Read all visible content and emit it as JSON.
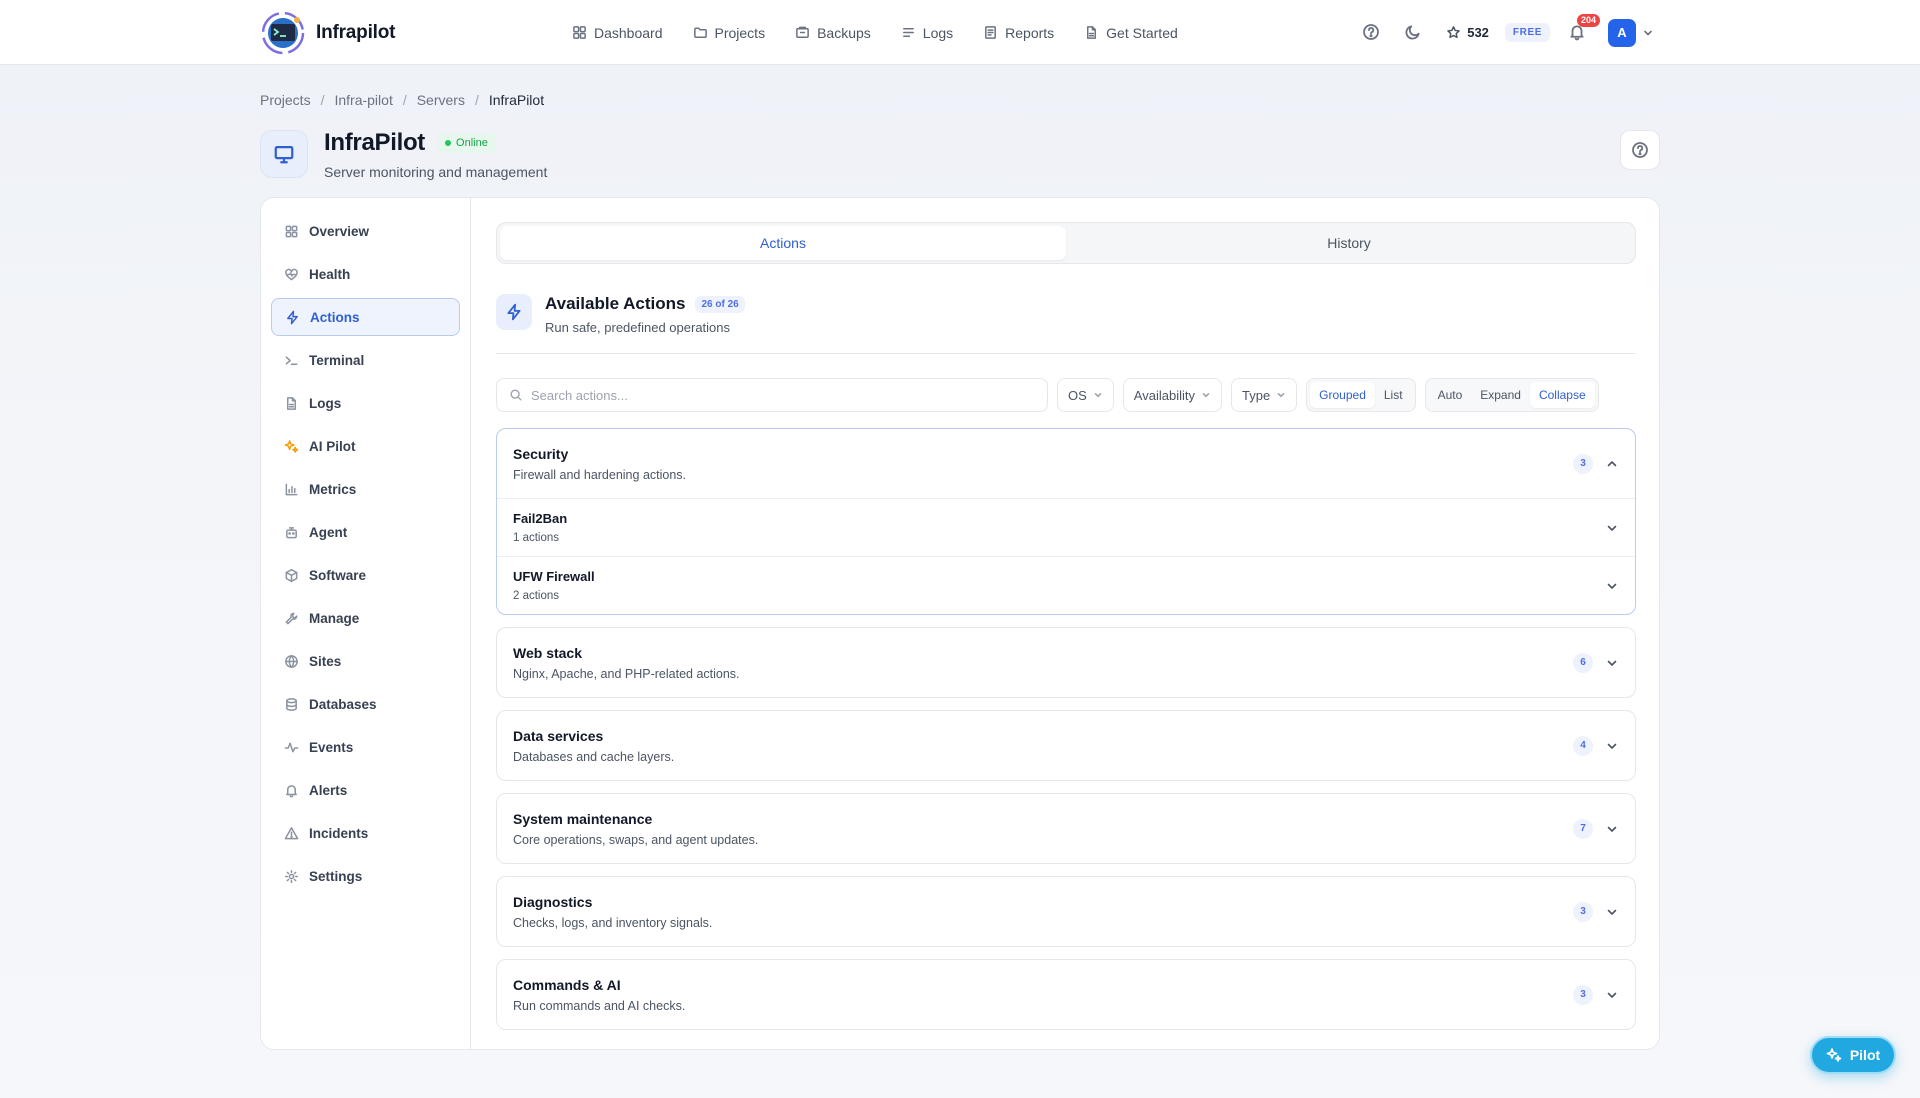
{
  "brand": {
    "name": "Infrapilot"
  },
  "nav": {
    "items": [
      {
        "label": "Dashboard",
        "icon": "dashboard-icon"
      },
      {
        "label": "Projects",
        "icon": "folder-icon"
      },
      {
        "label": "Backups",
        "icon": "archive-icon"
      },
      {
        "label": "Logs",
        "icon": "lines-icon"
      },
      {
        "label": "Reports",
        "icon": "report-icon"
      },
      {
        "label": "Get Started",
        "icon": "document-icon"
      }
    ]
  },
  "toolbar": {
    "stars": "532",
    "plan": "FREE",
    "notifications": "204",
    "avatar_initial": "A"
  },
  "breadcrumb": [
    "Projects",
    "Infra-pilot",
    "Servers",
    "InfraPilot"
  ],
  "header": {
    "title": "InfraPilot",
    "status": "Online",
    "subtitle": "Server monitoring and management"
  },
  "sidebar": {
    "items": [
      {
        "label": "Overview",
        "icon": "grid-icon"
      },
      {
        "label": "Health",
        "icon": "heart-icon"
      },
      {
        "label": "Actions",
        "icon": "bolt-icon",
        "active": true
      },
      {
        "label": "Terminal",
        "icon": "terminal-icon"
      },
      {
        "label": "Logs",
        "icon": "file-icon"
      },
      {
        "label": "AI Pilot",
        "icon": "sparkle-icon"
      },
      {
        "label": "Metrics",
        "icon": "bar-chart-icon"
      },
      {
        "label": "Agent",
        "icon": "bot-icon"
      },
      {
        "label": "Software",
        "icon": "package-icon"
      },
      {
        "label": "Manage",
        "icon": "wrench-icon"
      },
      {
        "label": "Sites",
        "icon": "globe-icon"
      },
      {
        "label": "Databases",
        "icon": "database-icon"
      },
      {
        "label": "Events",
        "icon": "activity-icon"
      },
      {
        "label": "Alerts",
        "icon": "bell-icon"
      },
      {
        "label": "Incidents",
        "icon": "warning-icon"
      },
      {
        "label": "Settings",
        "icon": "gear-icon"
      }
    ]
  },
  "tabs": [
    {
      "label": "Actions",
      "active": true
    },
    {
      "label": "History",
      "active": false
    }
  ],
  "section": {
    "title": "Available Actions",
    "count": "26 of 26",
    "subtitle": "Run safe, predefined operations"
  },
  "filters": {
    "search_placeholder": "Search actions...",
    "os": "OS",
    "availability": "Availability",
    "type": "Type",
    "view_modes": [
      "Grouped",
      "List"
    ],
    "view_active": "Grouped",
    "expand_modes": [
      "Auto",
      "Expand",
      "Collapse"
    ],
    "expand_active": "Collapse"
  },
  "groups": [
    {
      "name": "Security",
      "desc": "Firewall and hardening actions.",
      "count": "3",
      "open": true,
      "items": [
        {
          "name": "Fail2Ban",
          "desc": "1 actions"
        },
        {
          "name": "UFW Firewall",
          "desc": "2 actions"
        }
      ]
    },
    {
      "name": "Web stack",
      "desc": "Nginx, Apache, and PHP-related actions.",
      "count": "6"
    },
    {
      "name": "Data services",
      "desc": "Databases and cache layers.",
      "count": "4"
    },
    {
      "name": "System maintenance",
      "desc": "Core operations, swaps, and agent updates.",
      "count": "7"
    },
    {
      "name": "Diagnostics",
      "desc": "Checks, logs, and inventory signals.",
      "count": "3"
    },
    {
      "name": "Commands & AI",
      "desc": "Run commands and AI checks.",
      "count": "3"
    }
  ],
  "fab": {
    "label": "Pilot"
  },
  "colors": {
    "accent": "#2f5fd0",
    "online": "#22c55e",
    "fab": "#21a8e0",
    "badge_red": "#ef4444"
  }
}
